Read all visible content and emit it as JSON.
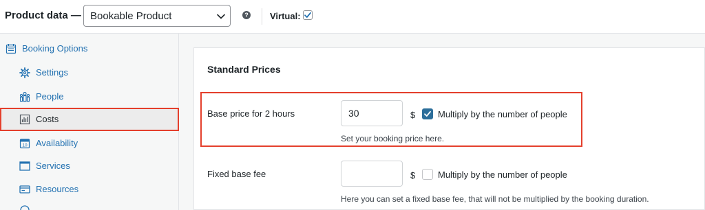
{
  "header": {
    "title": "Product data —",
    "product_type": "Bookable Product",
    "help_glyph": "?",
    "virtual_label": "Virtual:",
    "virtual_checked": true
  },
  "sidebar": {
    "items": [
      {
        "label": "Booking Options",
        "icon": "calendar-icon"
      },
      {
        "label": "Settings",
        "icon": "gear-icon"
      },
      {
        "label": "People",
        "icon": "people-icon"
      },
      {
        "label": "Costs",
        "icon": "chart-icon",
        "active": true
      },
      {
        "label": "Availability",
        "icon": "calendar-10-icon"
      },
      {
        "label": "Services",
        "icon": "window-icon"
      },
      {
        "label": "Resources",
        "icon": "card-icon"
      }
    ]
  },
  "main": {
    "section_title": "Standard Prices",
    "fields": [
      {
        "label": "Base price for 2 hours",
        "value": "30",
        "currency": "$",
        "checkbox_label": "Multiply by the number of people",
        "checked": true,
        "hint": "Set your booking price here."
      },
      {
        "label": "Fixed base fee",
        "value": "",
        "currency": "$",
        "checkbox_label": "Multiply by the number of people",
        "checked": false,
        "hint": "Here you can set a fixed base fee, that will not be multiplied by the booking duration."
      }
    ]
  },
  "colors": {
    "link": "#2271b1",
    "highlight": "#e43f2c",
    "checkbox_checked": "#2c6e9a"
  }
}
